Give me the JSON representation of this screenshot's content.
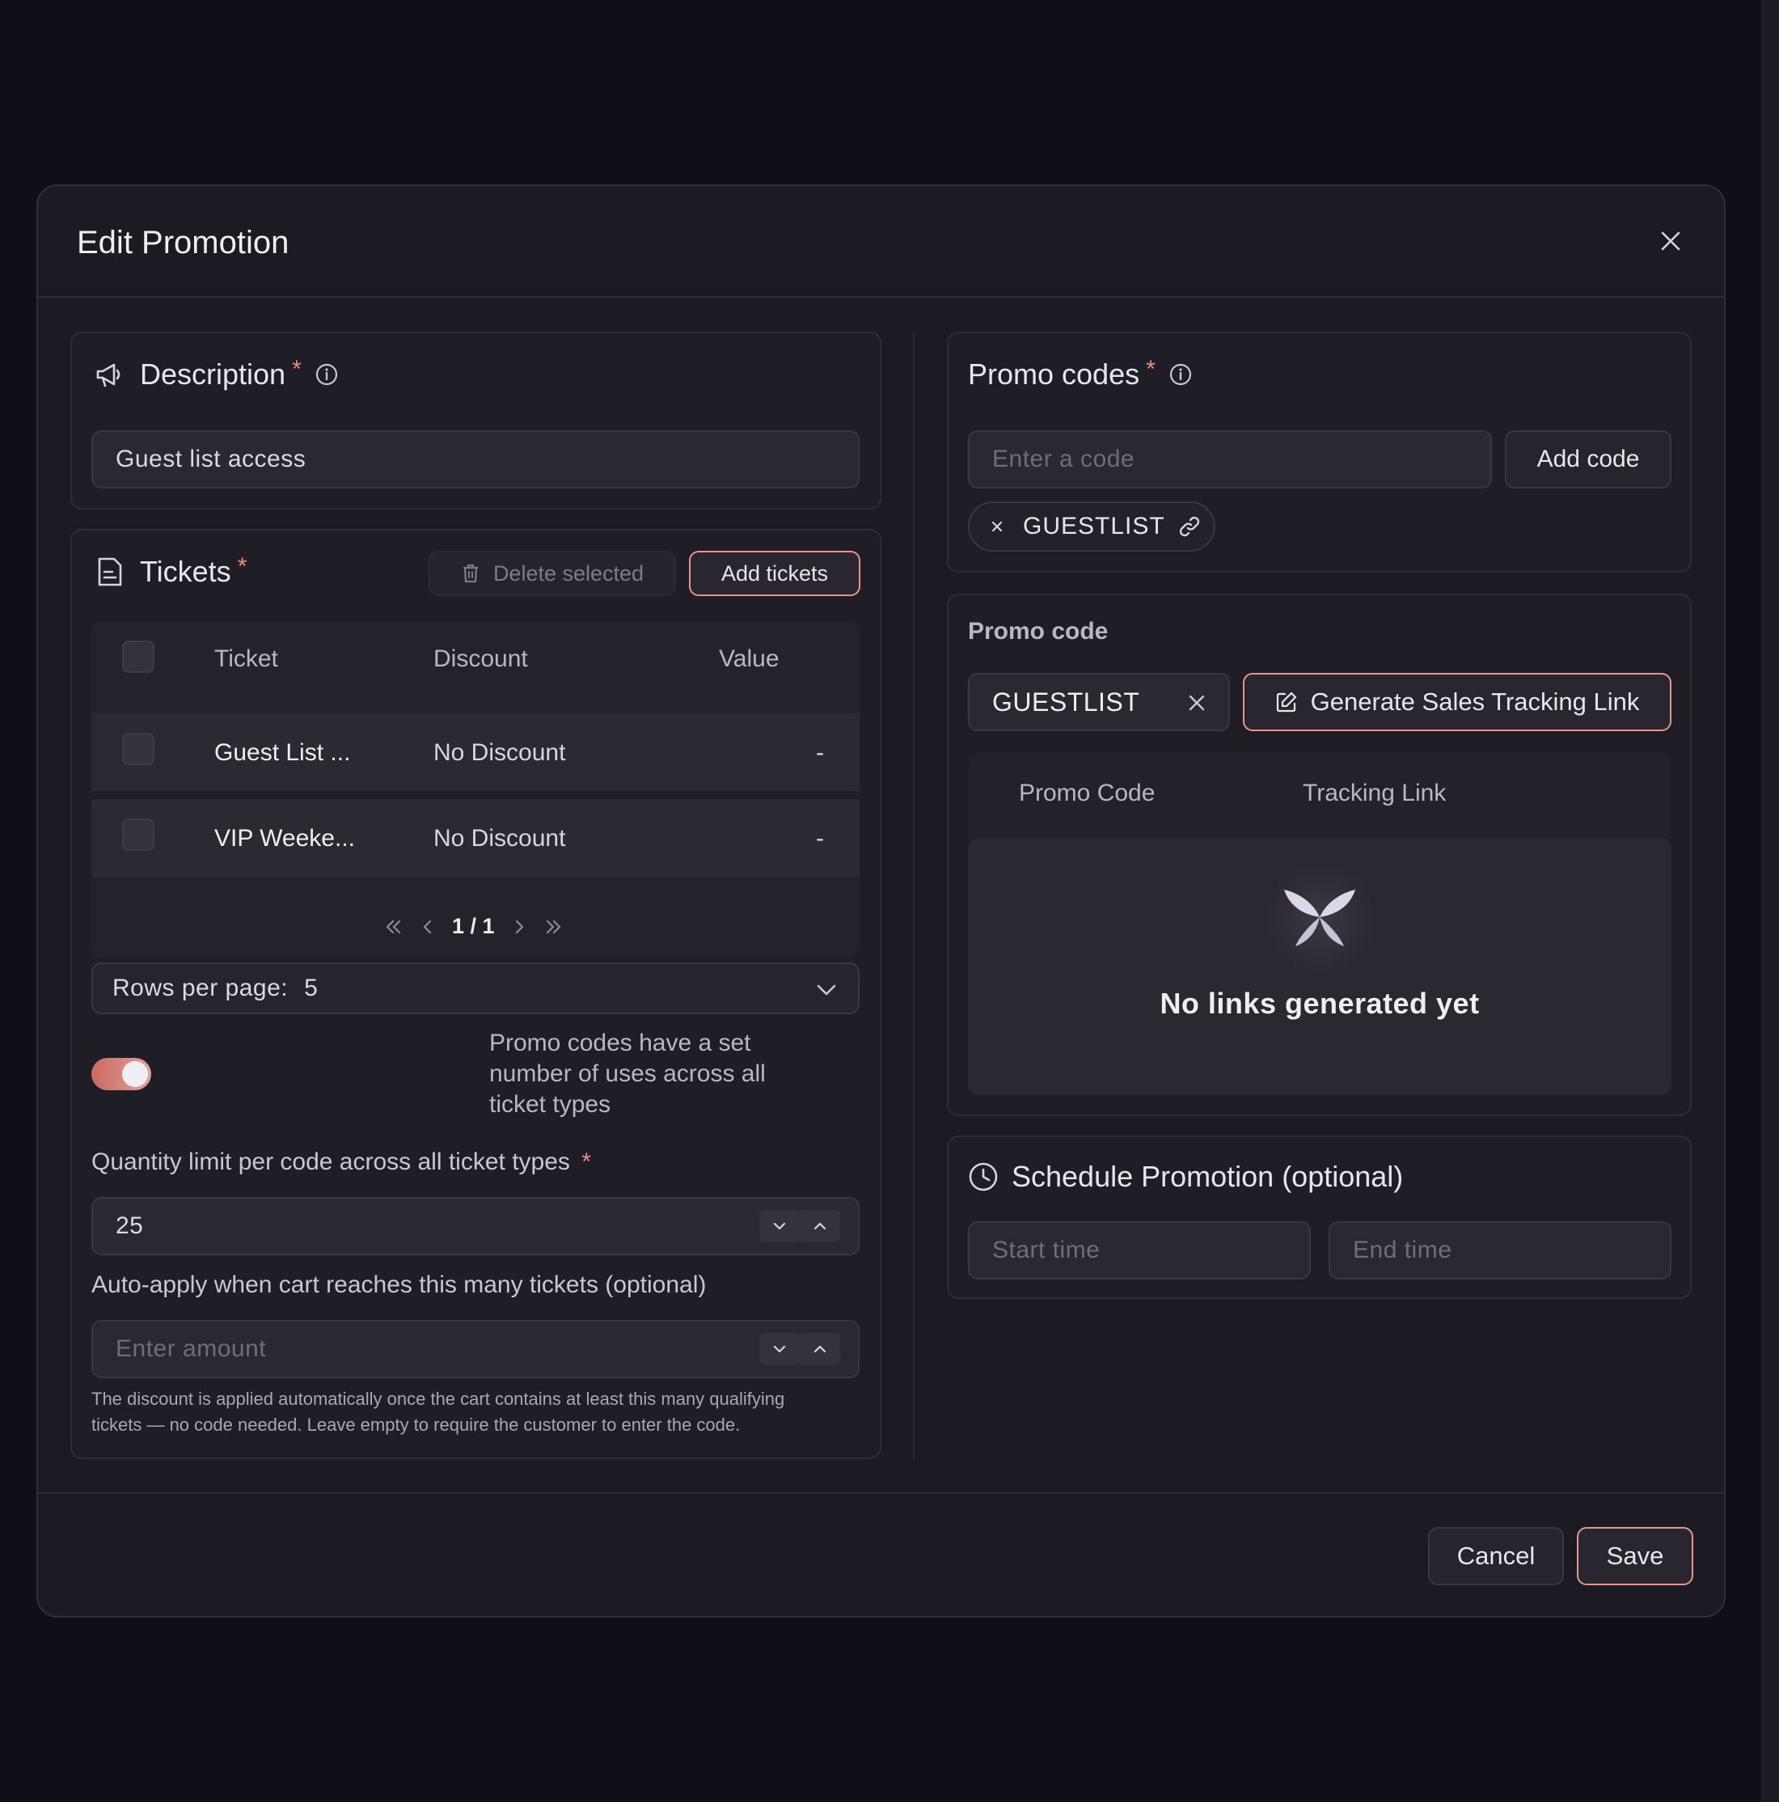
{
  "modal": {
    "title": "Edit Promotion"
  },
  "description": {
    "title": "Description",
    "required_mark": "*",
    "value": "Guest list access"
  },
  "tickets": {
    "title": "Tickets",
    "required_mark": "*",
    "delete_label": "Delete selected",
    "add_label": "Add tickets",
    "columns": [
      "Ticket",
      "Discount",
      "Value"
    ],
    "rows": [
      {
        "ticket": "Guest List ...",
        "discount": "No Discount",
        "value": "-"
      },
      {
        "ticket": "VIP Weeke...",
        "discount": "No Discount",
        "value": "-"
      }
    ],
    "pagination": "1 / 1",
    "rows_per_page_label": "Rows per page:",
    "rows_per_page_value": "5"
  },
  "uses": {
    "toggle_on": true,
    "toggle_text_line1": "Promo codes have a set",
    "toggle_text_line2": "number of uses across all",
    "toggle_text_line3": "ticket types",
    "quantity_label": "Quantity limit per code across all ticket types",
    "quantity_required": "*",
    "quantity_value": "25",
    "auto_label": "Auto-apply when cart reaches this many tickets (optional)",
    "auto_placeholder": "Enter amount",
    "help_line1": "The discount is applied automatically once the cart contains at least this many qualifying",
    "help_line2": "tickets — no code needed. Leave empty to require the customer to enter the code."
  },
  "promo_codes": {
    "title": "Promo codes",
    "required_mark": "*",
    "input_placeholder": "Enter a code",
    "add_label": "Add code",
    "chips": [
      "GUESTLIST"
    ]
  },
  "promo_code_panel": {
    "title": "Promo code",
    "selected_code": "GUESTLIST",
    "generate_label": "Generate Sales Tracking Link",
    "columns": [
      "Promo Code",
      "Tracking Link"
    ],
    "empty_text": "No links generated yet"
  },
  "schedule": {
    "title": "Schedule Promotion (optional)",
    "start_placeholder": "Start time",
    "end_placeholder": "End time"
  },
  "footer": {
    "cancel_label": "Cancel",
    "save_label": "Save"
  },
  "colors": {
    "accent": "#e8958a",
    "background": "#0f0f17",
    "surface": "#1c1b23"
  },
  "icons": {
    "close": "close-icon",
    "description": "megaphone-icon",
    "info": "info-icon",
    "tickets": "ticket-document-icon",
    "delete": "trash-icon",
    "link": "link-icon",
    "edit": "edit-icon",
    "clock": "clock-icon",
    "chevron_down": "chevron-down-icon",
    "chevron_up": "chevron-up-icon",
    "empty": "butterfly-logo-icon"
  }
}
